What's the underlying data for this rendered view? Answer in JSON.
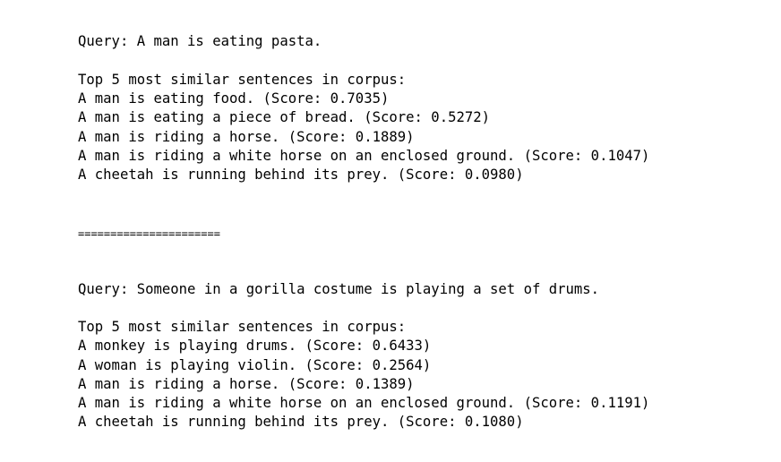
{
  "output": {
    "block1": {
      "query": "Query: A man is eating pasta.",
      "header": "Top 5 most similar sentences in corpus:",
      "results": [
        "A man is eating food. (Score: 0.7035)",
        "A man is eating a piece of bread. (Score: 0.5272)",
        "A man is riding a horse. (Score: 0.1889)",
        "A man is riding a white horse on an enclosed ground. (Score: 0.1047)",
        "A cheetah is running behind its prey. (Score: 0.0980)"
      ]
    },
    "separator": "======================",
    "block2": {
      "query": "Query: Someone in a gorilla costume is playing a set of drums.",
      "header": "Top 5 most similar sentences in corpus:",
      "results": [
        "A monkey is playing drums. (Score: 0.6433)",
        "A woman is playing violin. (Score: 0.2564)",
        "A man is riding a horse. (Score: 0.1389)",
        "A man is riding a white horse on an enclosed ground. (Score: 0.1191)",
        "A cheetah is running behind its prey. (Score: 0.1080)"
      ]
    }
  }
}
